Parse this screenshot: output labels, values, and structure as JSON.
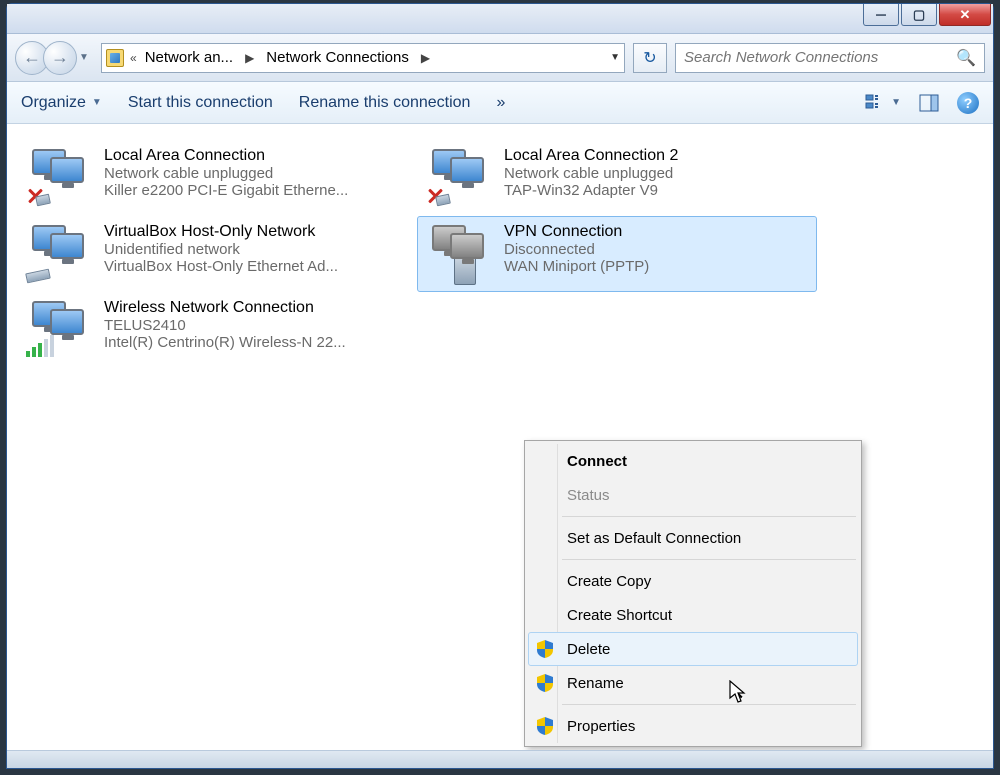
{
  "breadcrumb": {
    "root": "Network an...",
    "page": "Network Connections"
  },
  "search": {
    "placeholder": "Search Network Connections"
  },
  "toolbar": {
    "organize": "Organize",
    "start": "Start this connection",
    "rename": "Rename this connection",
    "overflow": "»"
  },
  "connections": [
    {
      "title": "Local Area Connection",
      "status": "Network cable unplugged",
      "device": "Killer e2200 PCI-E Gigabit Etherne...",
      "statusIcon": "x-plug"
    },
    {
      "title": "Local Area Connection 2",
      "status": "Network cable unplugged",
      "device": "TAP-Win32 Adapter V9",
      "statusIcon": "x-plug"
    },
    {
      "title": "VirtualBox Host-Only Network",
      "status": "Unidentified network",
      "device": "VirtualBox Host-Only Ethernet Ad...",
      "statusIcon": "plug"
    },
    {
      "title": "VPN Connection",
      "status": "Disconnected",
      "device": "WAN Miniport (PPTP)",
      "statusIcon": "server",
      "selected": true
    },
    {
      "title": "Wireless Network Connection",
      "status": "TELUS2410",
      "device": "Intel(R) Centrino(R) Wireless-N 22...",
      "statusIcon": "bars"
    }
  ],
  "contextMenu": {
    "connect": "Connect",
    "status": "Status",
    "setDefault": "Set as Default Connection",
    "createCopy": "Create Copy",
    "createShortcut": "Create Shortcut",
    "delete": "Delete",
    "rename": "Rename",
    "properties": "Properties"
  }
}
